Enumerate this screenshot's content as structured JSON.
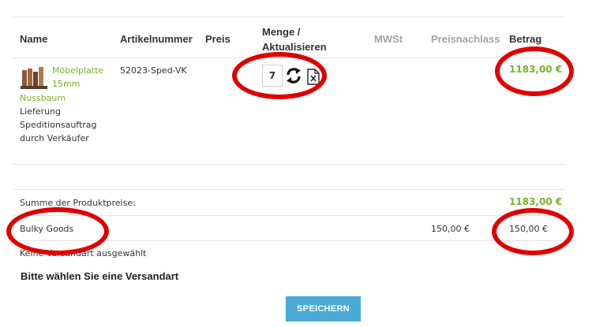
{
  "table": {
    "headers": {
      "name": "Name",
      "article_number": "Artikelnummer",
      "price": "Preis",
      "quantity_line1": "Menge /",
      "quantity_line2": "Aktualisieren",
      "vat": "MWSt",
      "discount": "Preisnachlass",
      "amount": "Betrag"
    },
    "product": {
      "name_line1": "Möbelplatte",
      "name_line2": "15mm",
      "name_line3": "Nussbaum",
      "desc_line1": "Lieferung",
      "desc_line2": "Speditionsauftrag",
      "desc_line3": "durch Verkäufer",
      "article_number": "52023-Sped-VK",
      "quantity": "7",
      "amount": "1183,00 €"
    }
  },
  "summary": {
    "subtotal_label": "Summe der Produktpreise:",
    "subtotal_value": "1183,00 €",
    "bulky_label": "Bulky Goods",
    "bulky_discount": "150,00 €",
    "bulky_amount": "150,00 €",
    "no_shipping_text": "Keine Versandart ausgewählt",
    "choose_shipping": "Bitte wählen Sie eine Versandart"
  },
  "buttons": {
    "save_label": "SPEICHERN"
  },
  "icons": {
    "refresh": "refresh-icon",
    "delete": "delete-icon",
    "product": "product-image"
  },
  "colors": {
    "accent_green": "#7ab32e",
    "button_blue": "#4aaad6",
    "annotation_red": "#e00000"
  }
}
